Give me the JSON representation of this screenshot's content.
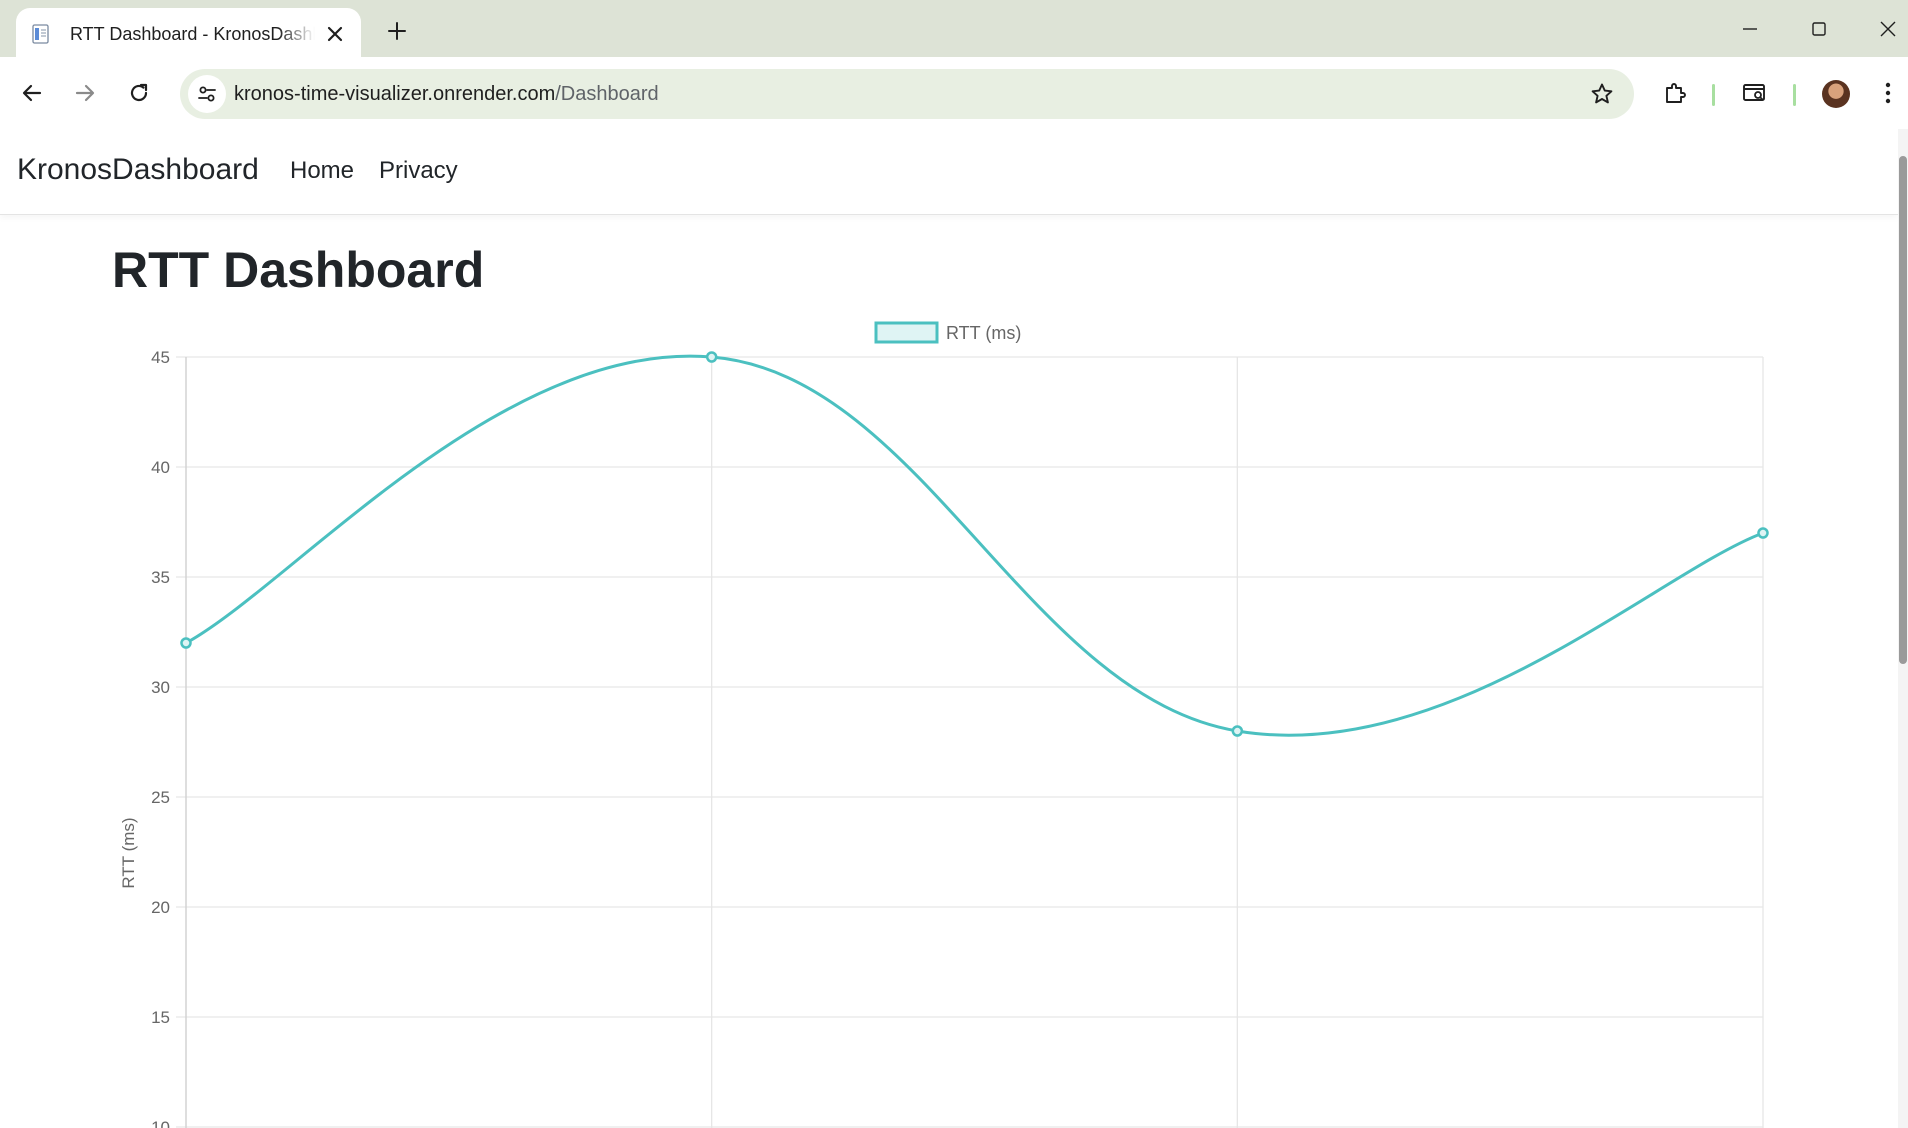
{
  "browser": {
    "tab_title": "RTT Dashboard - KronosDashboard",
    "url_domain": "kronos-time-visualizer.onrender.com",
    "url_path": "/Dashboard"
  },
  "site": {
    "brand": "KronosDashboard",
    "nav": [
      "Home",
      "Privacy"
    ]
  },
  "page": {
    "title": "RTT Dashboard"
  },
  "chart_data": {
    "type": "line",
    "x": [
      "",
      "",
      "",
      ""
    ],
    "series": [
      {
        "name": "RTT (ms)",
        "values": [
          32,
          45,
          28,
          37
        ]
      }
    ],
    "ylabel": "RTT (ms)",
    "xlabel": "",
    "title": "",
    "y_ticks": [
      "45",
      "40",
      "35",
      "30",
      "25",
      "20",
      "15",
      "10"
    ],
    "ylim": [
      10,
      45
    ],
    "line_color": "#4bc0c0",
    "fill_color": "#dff4f4",
    "curve": "smooth",
    "grid": true,
    "legend": "top-center"
  }
}
